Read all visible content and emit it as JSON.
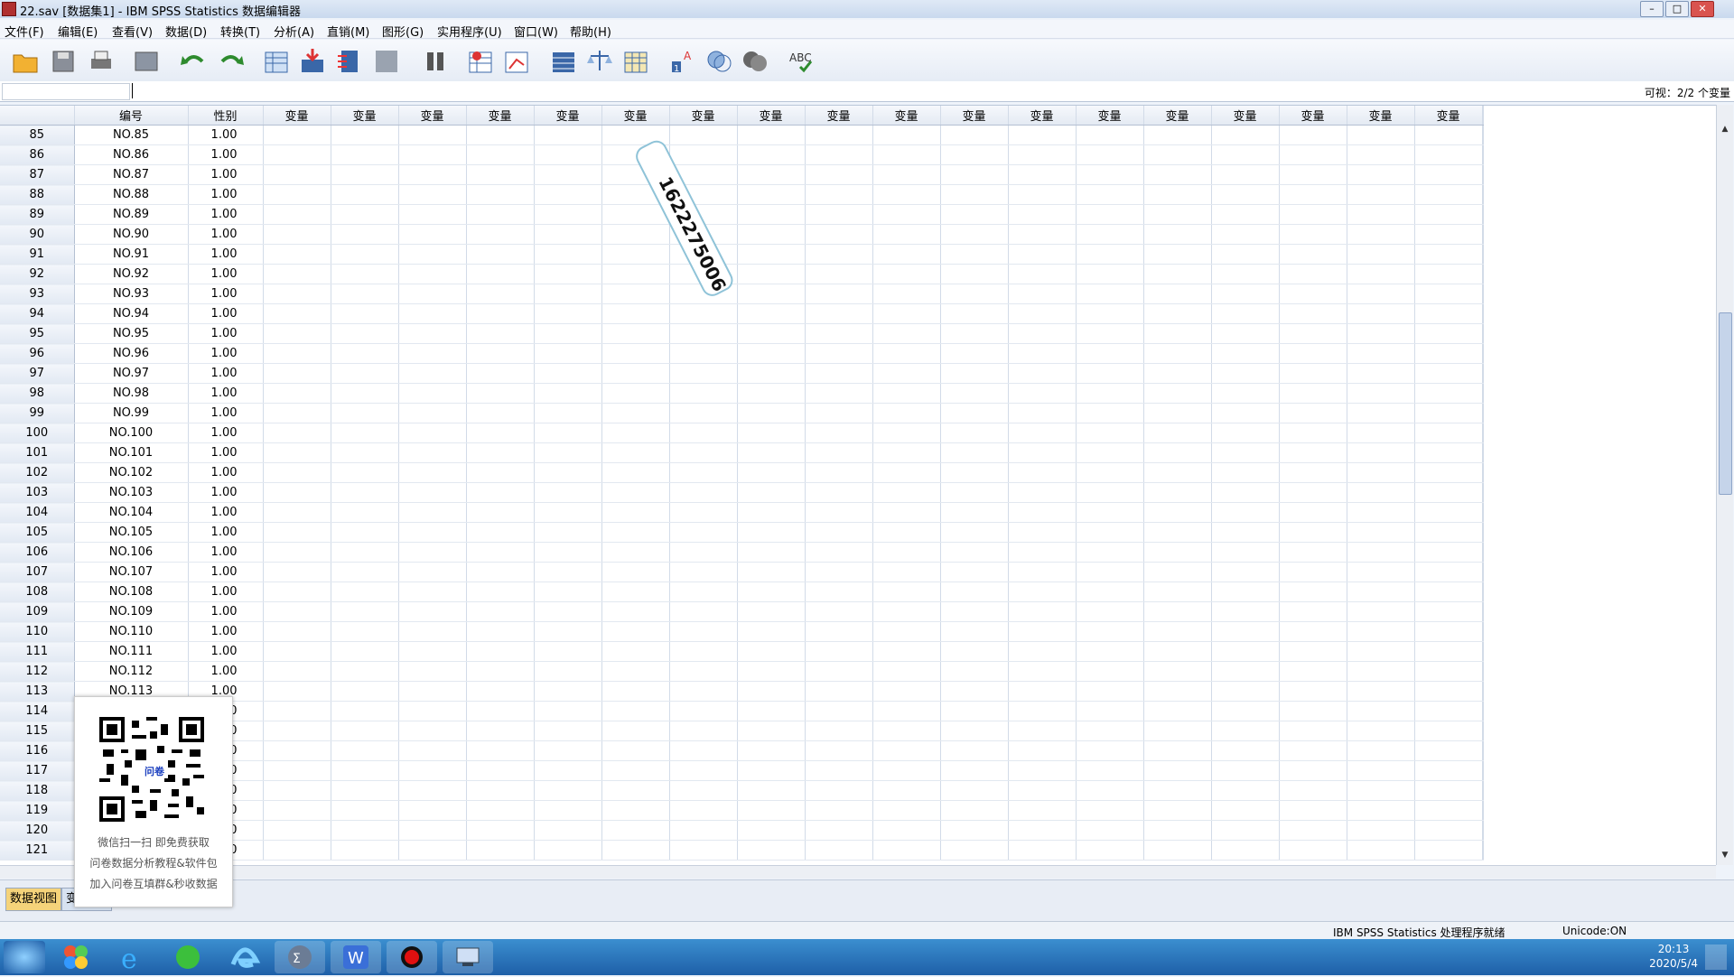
{
  "window": {
    "title": "22.sav [数据集1] - IBM SPSS Statistics 数据编辑器"
  },
  "menu": [
    "文件(F)",
    "编辑(E)",
    "查看(V)",
    "数据(D)",
    "转换(T)",
    "分析(A)",
    "直销(M)",
    "图形(G)",
    "实用程序(U)",
    "窗口(W)",
    "帮助(H)"
  ],
  "toolbar_icons": [
    "open-icon",
    "save-icon",
    "print-icon",
    "dialog-recall-icon",
    "undo-icon",
    "redo-icon",
    "goto-case-icon",
    "goto-variable-icon",
    "variables-icon",
    "run-descriptive-icon",
    "find-icon",
    "insert-cases-icon",
    "insert-variable-icon",
    "split-file-icon",
    "weight-cases-icon",
    "select-cases-icon",
    "value-labels-icon",
    "use-variable-sets-icon",
    "show-all-variables-icon",
    "spell-check-icon"
  ],
  "formula_bar": {
    "visible": "可视：2/2 个变量"
  },
  "columns": [
    "编号",
    "性别",
    "变量",
    "变量",
    "变量",
    "变量",
    "变量",
    "变量",
    "变量",
    "变量",
    "变量",
    "变量",
    "变量",
    "变量",
    "变量",
    "变量",
    "变量",
    "变量",
    "变量",
    "变量"
  ],
  "rows": [
    {
      "n": "85",
      "id": "NO.85",
      "sex": "1.00"
    },
    {
      "n": "86",
      "id": "NO.86",
      "sex": "1.00"
    },
    {
      "n": "87",
      "id": "NO.87",
      "sex": "1.00"
    },
    {
      "n": "88",
      "id": "NO.88",
      "sex": "1.00"
    },
    {
      "n": "89",
      "id": "NO.89",
      "sex": "1.00"
    },
    {
      "n": "90",
      "id": "NO.90",
      "sex": "1.00"
    },
    {
      "n": "91",
      "id": "NO.91",
      "sex": "1.00"
    },
    {
      "n": "92",
      "id": "NO.92",
      "sex": "1.00"
    },
    {
      "n": "93",
      "id": "NO.93",
      "sex": "1.00"
    },
    {
      "n": "94",
      "id": "NO.94",
      "sex": "1.00"
    },
    {
      "n": "95",
      "id": "NO.95",
      "sex": "1.00"
    },
    {
      "n": "96",
      "id": "NO.96",
      "sex": "1.00"
    },
    {
      "n": "97",
      "id": "NO.97",
      "sex": "1.00"
    },
    {
      "n": "98",
      "id": "NO.98",
      "sex": "1.00"
    },
    {
      "n": "99",
      "id": "NO.99",
      "sex": "1.00"
    },
    {
      "n": "100",
      "id": "NO.100",
      "sex": "1.00"
    },
    {
      "n": "101",
      "id": "NO.101",
      "sex": "1.00"
    },
    {
      "n": "102",
      "id": "NO.102",
      "sex": "1.00"
    },
    {
      "n": "103",
      "id": "NO.103",
      "sex": "1.00"
    },
    {
      "n": "104",
      "id": "NO.104",
      "sex": "1.00"
    },
    {
      "n": "105",
      "id": "NO.105",
      "sex": "1.00"
    },
    {
      "n": "106",
      "id": "NO.106",
      "sex": "1.00"
    },
    {
      "n": "107",
      "id": "NO.107",
      "sex": "1.00"
    },
    {
      "n": "108",
      "id": "NO.108",
      "sex": "1.00"
    },
    {
      "n": "109",
      "id": "NO.109",
      "sex": "1.00"
    },
    {
      "n": "110",
      "id": "NO.110",
      "sex": "1.00"
    },
    {
      "n": "111",
      "id": "NO.111",
      "sex": "1.00"
    },
    {
      "n": "112",
      "id": "NO.112",
      "sex": "1.00"
    },
    {
      "n": "113",
      "id": "NO.113",
      "sex": "1.00"
    },
    {
      "n": "114",
      "id": "",
      "sex": "0"
    },
    {
      "n": "115",
      "id": "",
      "sex": "0"
    },
    {
      "n": "116",
      "id": "",
      "sex": "0"
    },
    {
      "n": "117",
      "id": "",
      "sex": "0"
    },
    {
      "n": "118",
      "id": "",
      "sex": "0"
    },
    {
      "n": "119",
      "id": "",
      "sex": "0"
    },
    {
      "n": "120",
      "id": "",
      "sex": "0"
    },
    {
      "n": "121",
      "id": "",
      "sex": "0"
    }
  ],
  "tabs": {
    "data_view": "数据视图",
    "variable_view": "变"
  },
  "status": {
    "processor": "IBM SPSS Statistics 处理程序就绪",
    "unicode": "Unicode:ON"
  },
  "overlay": {
    "watermark": "1622275006",
    "qr_center": "问卷",
    "qr_lines": [
      "微信扫一扫 即免费获取",
      "问卷数据分析教程&软件包",
      "加入问卷互填群&秒收数据"
    ]
  },
  "taskbar": {
    "time": "20:13",
    "date": "2020/5/4"
  },
  "colors": {
    "header_bg": "#e4eaf3",
    "grid_line": "#d2dbe8",
    "taskbar": "#1e5fa8",
    "active_tab": "#f5d37a"
  }
}
